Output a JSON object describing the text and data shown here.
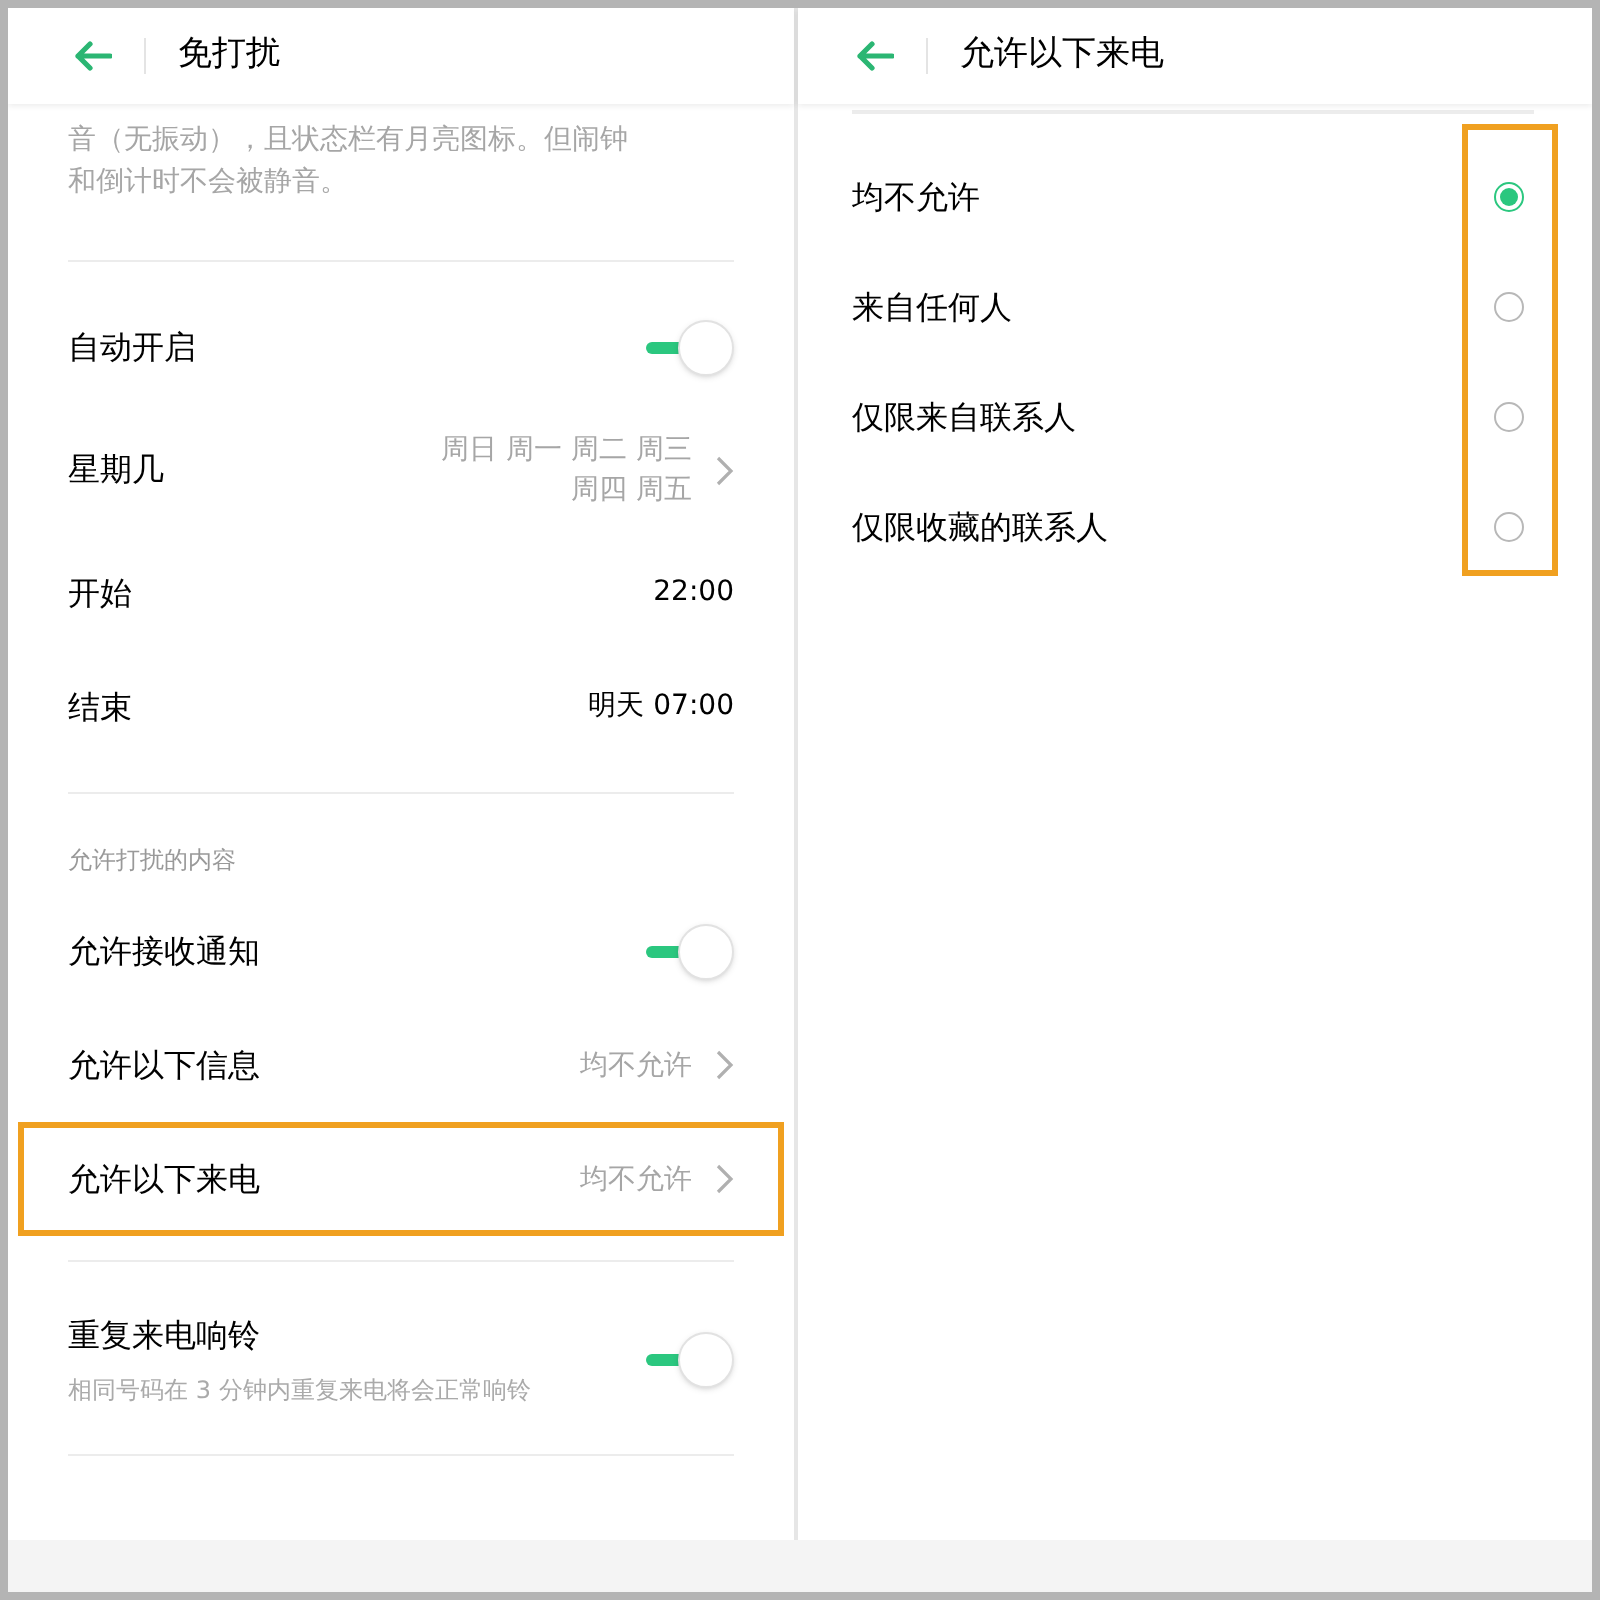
{
  "left": {
    "title": "免打扰",
    "description": "音（无振动），且状态栏有月亮图标。但闹钟和倒计时不会被静音。",
    "groups": [
      {
        "items": [
          {
            "kind": "toggle",
            "label": "自动开启",
            "on": true
          },
          {
            "kind": "link",
            "label": "星期几",
            "value_lines": [
              "周日 周一 周二 周三",
              "周四 周五"
            ]
          },
          {
            "kind": "value",
            "label": "开始",
            "value": "22:00"
          },
          {
            "kind": "value",
            "label": "结束",
            "value": "明天 07:00"
          }
        ]
      },
      {
        "header": "允许打扰的内容",
        "items": [
          {
            "kind": "toggle",
            "label": "允许接收通知",
            "on": true
          },
          {
            "kind": "link",
            "label": "允许以下信息",
            "value_lines": [
              "均不允许"
            ],
            "highlighted": false
          },
          {
            "kind": "link",
            "label": "允许以下来电",
            "value_lines": [
              "均不允许"
            ],
            "highlighted": true
          }
        ]
      },
      {
        "items": [
          {
            "kind": "toggle",
            "label": "重复来电响铃",
            "subtitle": "相同号码在 3 分钟内重复来电将会正常响铃",
            "on": true
          }
        ]
      }
    ]
  },
  "right": {
    "title": "允许以下来电",
    "radios_highlighted": true,
    "options": [
      {
        "label": "均不允许",
        "selected": true
      },
      {
        "label": "来自任何人",
        "selected": false
      },
      {
        "label": "仅限来自联系人",
        "selected": false
      },
      {
        "label": "仅限收藏的联系人",
        "selected": false
      }
    ]
  }
}
